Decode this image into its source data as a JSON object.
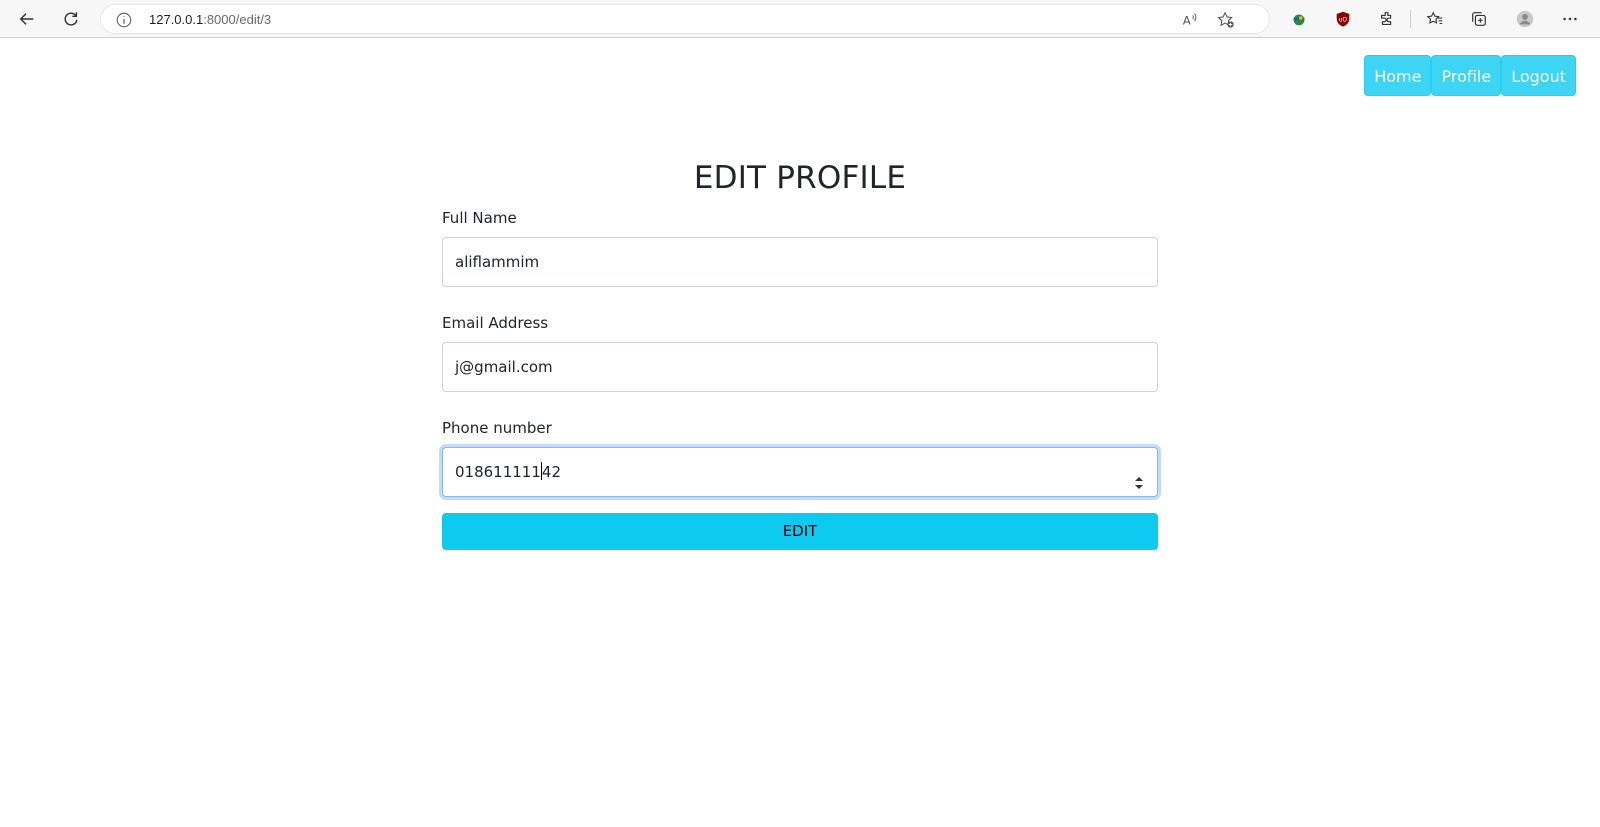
{
  "browser": {
    "url_host": "127.0.0.1",
    "url_path": ":8000/edit/3",
    "icons": [
      "back-icon",
      "refresh-icon",
      "info-icon",
      "read-aloud-icon",
      "favorite-add-icon",
      "extension-globe-icon",
      "ublock-icon",
      "extensions-icon",
      "favorites-icon",
      "collections-icon",
      "profile-icon",
      "more-icon"
    ]
  },
  "nav": {
    "home": "Home",
    "profile": "Profile",
    "logout": "Logout"
  },
  "form": {
    "title": "EDIT PROFILE",
    "fullname_label": "Full Name",
    "fullname_value": "aliflammim",
    "email_label": "Email Address",
    "email_value": "j@gmail.com",
    "phone_label": "Phone number",
    "phone_value_before_caret": "018611111",
    "phone_value_after_caret": "42",
    "submit_label": "EDIT"
  },
  "colors": {
    "nav_button": "#3dd5f3",
    "submit_button": "#0dcaf0",
    "focus_ring": "#86b7fe"
  }
}
